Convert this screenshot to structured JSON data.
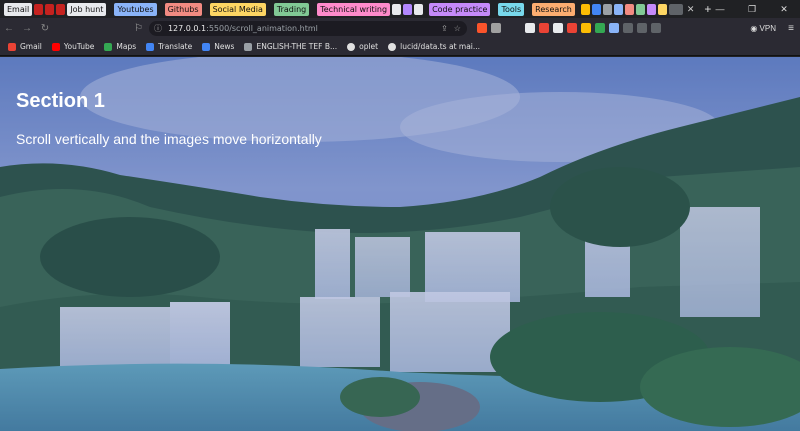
{
  "tabs": {
    "groups": [
      {
        "label": "Email",
        "color": "#e8eaed"
      },
      {
        "label": "Job hunt",
        "color": "#e8eaed"
      },
      {
        "label": "Youtubes",
        "color": "#8ab4f8"
      },
      {
        "label": "Githubs",
        "color": "#f28b82"
      },
      {
        "label": "Social Media",
        "color": "#fdd663"
      },
      {
        "label": "Trading",
        "color": "#81c995"
      },
      {
        "label": "Technical writing",
        "color": "#ff8bcb"
      },
      {
        "label": "Code practice",
        "color": "#c58af9"
      },
      {
        "label": "Tools",
        "color": "#78d9ec"
      },
      {
        "label": "Research",
        "color": "#fcad70"
      }
    ],
    "new_tab_icon": "plus-icon"
  },
  "toolbar": {
    "url_host": "127.0.0.1",
    "url_path": ":5500/scroll_animation.html",
    "vpn_label": "VPN"
  },
  "bookmarks": [
    {
      "label": "Gmail",
      "icon": "gmail-icon",
      "color": "#ea4335"
    },
    {
      "label": "YouTube",
      "icon": "youtube-icon",
      "color": "#ff0000"
    },
    {
      "label": "Maps",
      "icon": "maps-icon",
      "color": "#34a853"
    },
    {
      "label": "Translate",
      "icon": "translate-icon",
      "color": "#4285f4"
    },
    {
      "label": "News",
      "icon": "news-icon",
      "color": "#4285f4"
    },
    {
      "label": "ENGLISH-THE TEF B...",
      "icon": "doc-icon",
      "color": "#9aa0a6"
    },
    {
      "label": "oplet",
      "icon": "github-icon",
      "color": "#e0e0e0"
    },
    {
      "label": "lucid/data.ts at mai...",
      "icon": "github-icon",
      "color": "#e0e0e0"
    }
  ],
  "page": {
    "title": "Section 1",
    "subtitle": "Scroll vertically and the images move horizontally"
  }
}
